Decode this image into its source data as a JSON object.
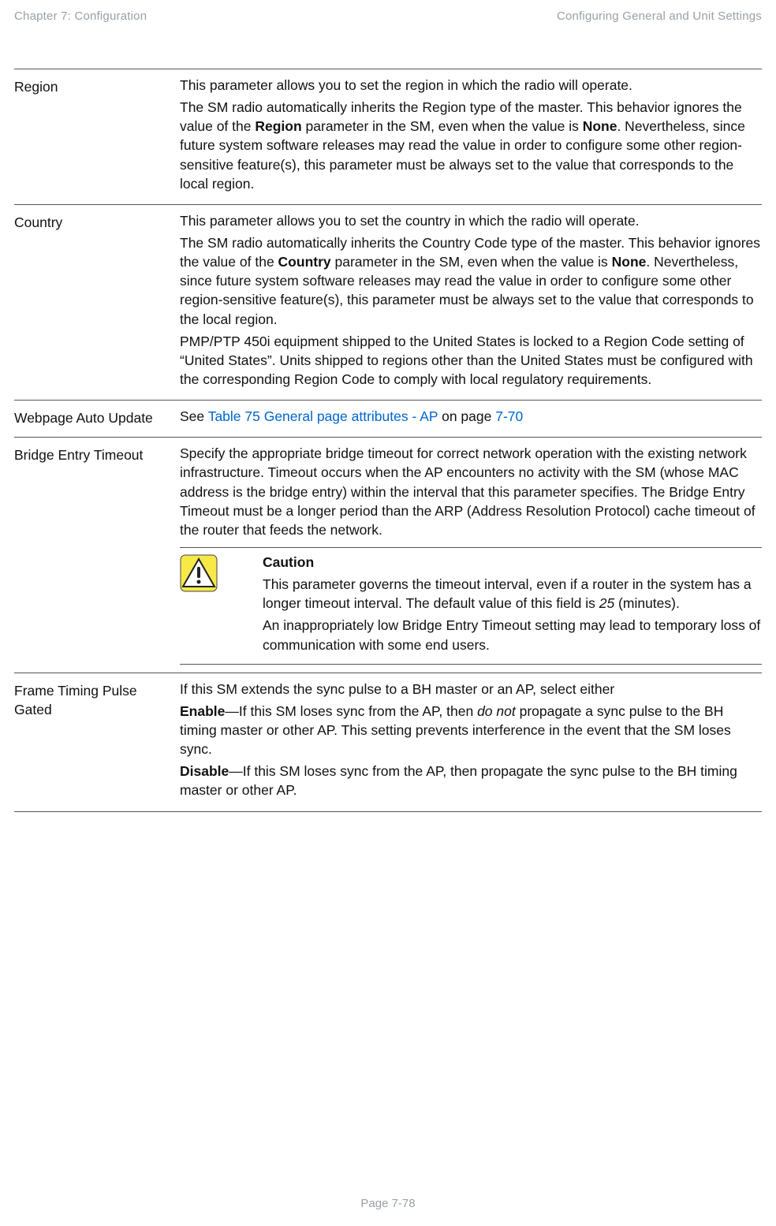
{
  "header": {
    "left": "Chapter 7:  Configuration",
    "right": "Configuring General and Unit Settings"
  },
  "rows": {
    "region": {
      "label": "Region",
      "p1": "This parameter allows you to set the region in which the radio will operate.",
      "p2a": "The SM radio automatically inherits the Region type of the master. This behavior ignores the value of the ",
      "p2b": "Region",
      "p2c": " parameter in the SM, even when the value is ",
      "p2d": "None",
      "p2e": ". Nevertheless, since future system software releases may read the value in order to configure some other region-sensitive feature(s), this parameter must be always set to the value that corresponds to the local region."
    },
    "country": {
      "label": "Country",
      "p1": "This parameter allows you to set the country in which the radio will operate.",
      "p2a": "The SM radio automatically inherits the Country Code type of the master. This behavior ignores the value of the ",
      "p2b": "Country",
      "p2c": " parameter in the SM, even when the value is ",
      "p2d": "None",
      "p2e": ". Nevertheless, since future system software releases may read the value in order to configure some other region-sensitive feature(s), this parameter must be always set to the value that corresponds to the local region.",
      "p3": "PMP/PTP 450i equipment shipped to the United States is locked to a Region Code setting of “United States”.  Units shipped to regions other than the United States must be configured with the corresponding Region Code to comply with local regulatory requirements."
    },
    "webpage": {
      "label": "Webpage Auto Update",
      "pre": "See ",
      "link1": "Table 75 General page attributes - AP",
      "mid": " on page ",
      "link2": "7-70"
    },
    "bridge": {
      "label": "Bridge Entry Timeout",
      "p1": "Specify the appropriate bridge timeout for correct network operation with the existing network infrastructure. Timeout occurs when the AP encounters no activity with the SM (whose MAC address is the bridge entry) within the interval that this parameter specifies. The Bridge Entry Timeout must be a longer period than the ARP (Address Resolution Protocol) cache timeout of the router that feeds the network.",
      "callout": {
        "title": "Caution",
        "p1a": "This parameter governs the timeout interval, even if a router in the system has a longer timeout interval. The default value of this field is ",
        "p1b": "25",
        "p1c": " (minutes).",
        "p2": "An inappropriately low Bridge Entry Timeout setting may lead to temporary loss of communication with some end users."
      }
    },
    "frame": {
      "label": "Frame Timing Pulse Gated",
      "p1": "If this SM extends the sync pulse to a BH master or an AP, select either",
      "p2a": "Enable",
      "p2b": "—If this SM loses sync from the AP, then ",
      "p2c": "do not",
      "p2d": " propagate a sync pulse to the BH timing master or other AP. This setting prevents interference in the event that the SM loses sync.",
      "p3a": "Disable",
      "p3b": "—If this SM loses sync from the AP, then propagate the sync pulse to the BH timing master or other AP."
    }
  },
  "footer": "Page 7-78"
}
